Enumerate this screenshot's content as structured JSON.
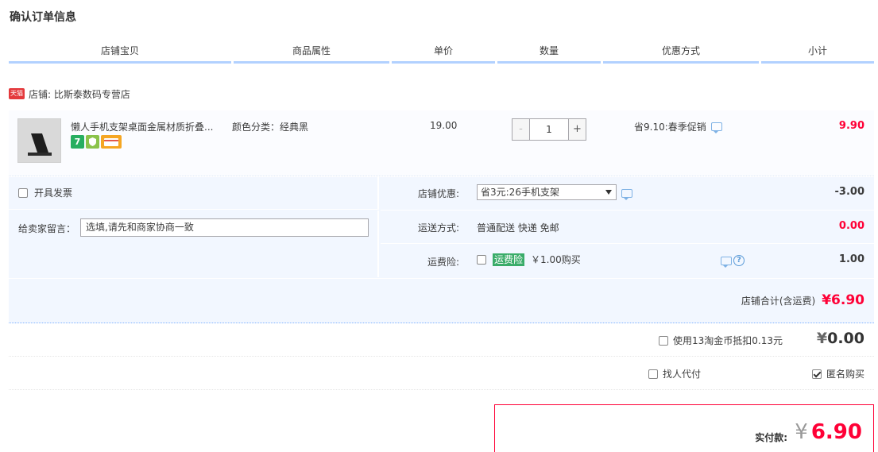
{
  "page_title": "确认订单信息",
  "columns": [
    "店铺宝贝",
    "商品属性",
    "单价",
    "数量",
    "优惠方式",
    "小计"
  ],
  "shop": {
    "badge": "天猫",
    "label": "店铺: 比斯泰数码专营店"
  },
  "item": {
    "title": "懒人手机支架桌面金属材质折叠...",
    "attribute": "颜色分类：经典黑",
    "unit_price": "19.00",
    "quantity": "1",
    "minus": "-",
    "plus": "+",
    "promotion": "省9.10:春季促销",
    "subtotal": "9.90",
    "service_icons": [
      "seven-day-return-icon",
      "guarantee-icon",
      "credit-card-icon"
    ],
    "service_badge_seven": "7"
  },
  "options": {
    "invoice_label": "开具发票",
    "message_label": "给卖家留言：",
    "message_placeholder": "选填,请先和商家协商一致",
    "shop_discount_label": "店铺优惠:",
    "shop_discount_value": "省3元:26手机支架",
    "shop_discount_amount": "-3.00",
    "shipping_label": "运送方式:",
    "shipping_value": "普通配送 快递 免邮",
    "shipping_amount": "0.00",
    "insurance_label": "运费险:",
    "insurance_badge": "运费险",
    "insurance_price": "￥1.00购买",
    "insurance_amount": "1.00",
    "help_glyph": "?",
    "shop_total_label": "店铺合计(含运费)",
    "shop_total_amount": "¥6.90"
  },
  "coins": {
    "label": "使用13淘金币抵扣0.13元",
    "yen": "¥",
    "amount": "0.00"
  },
  "extras": {
    "proxy_label": "找人代付",
    "anonymous_label": "匿名购买",
    "anonymous_checked": true
  },
  "payment": {
    "label": "实付款:",
    "yen": "¥",
    "amount": "6.90"
  },
  "colors": {
    "accent_red": "#ff0036",
    "header_border": "#b2d1ff",
    "option_bg": "#f2f7ff"
  }
}
